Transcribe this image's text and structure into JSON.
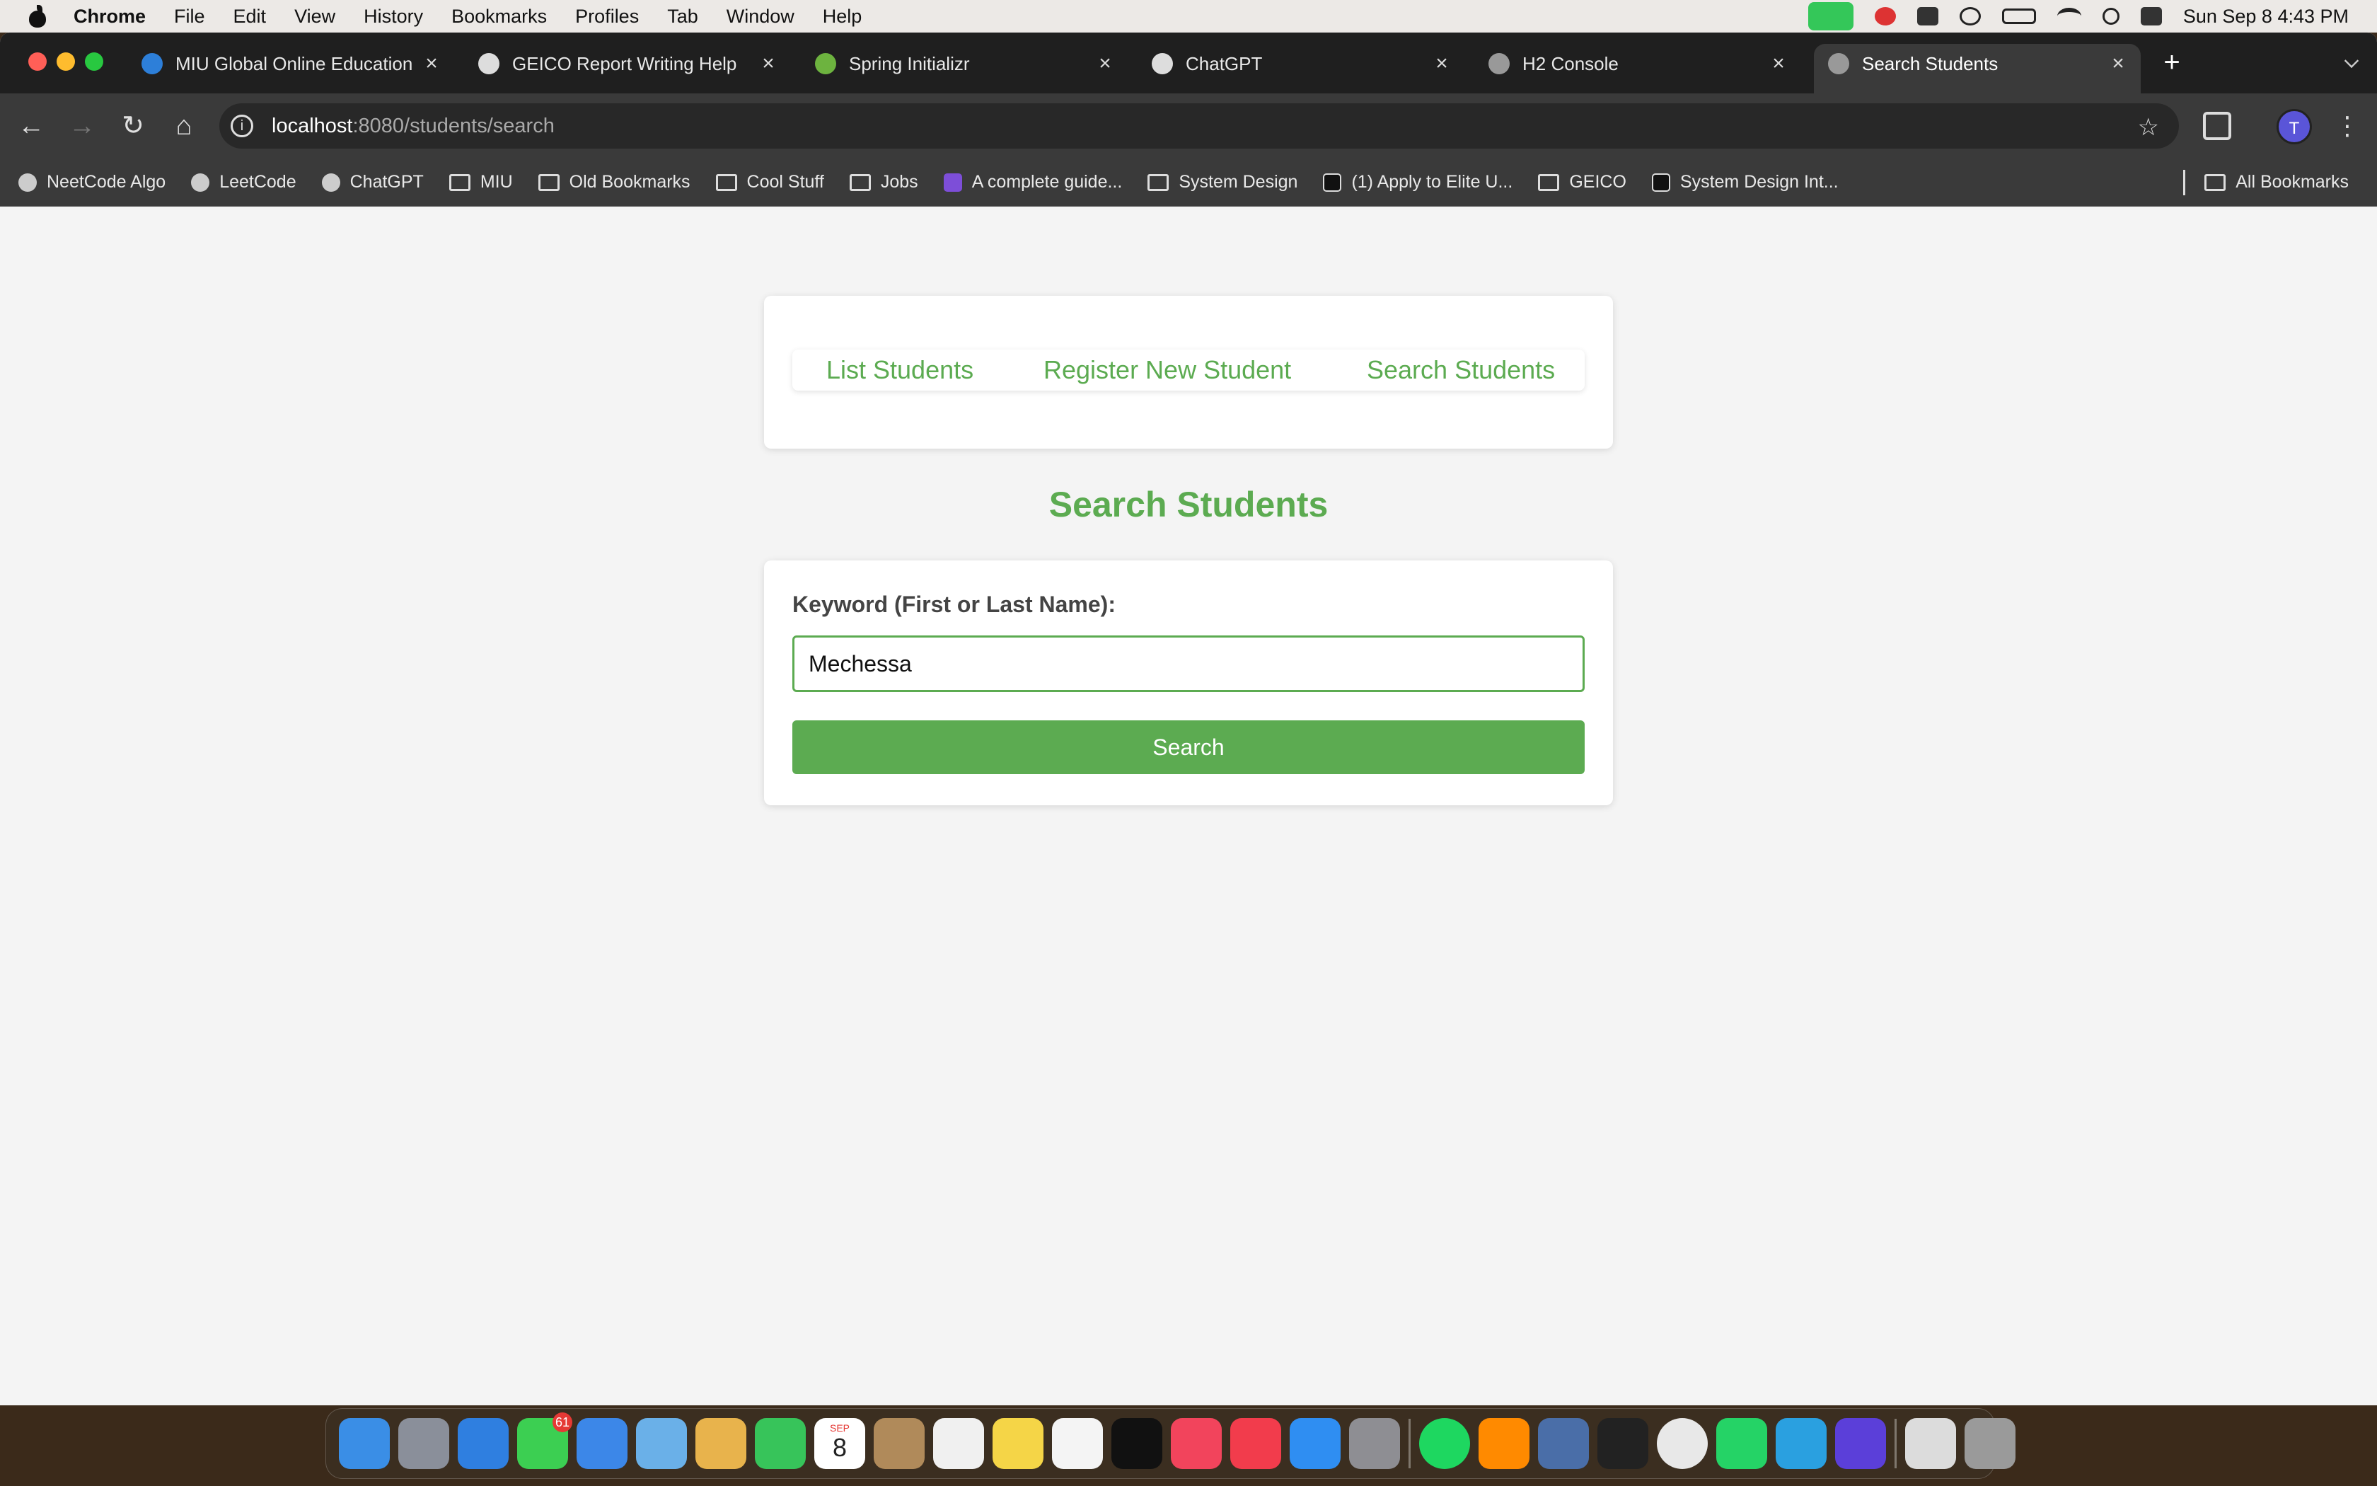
{
  "menubar": {
    "app_name": "Chrome",
    "items": [
      "File",
      "Edit",
      "View",
      "History",
      "Bookmarks",
      "Profiles",
      "Tab",
      "Window",
      "Help"
    ],
    "clock": "Sun Sep 8  4:43 PM"
  },
  "tabs": [
    {
      "title": "MIU Global Online Education :",
      "icon": "miu-icon"
    },
    {
      "title": "GEICO Report Writing Help",
      "icon": "chatgpt-icon"
    },
    {
      "title": "Spring Initializr",
      "icon": "spring-icon"
    },
    {
      "title": "ChatGPT",
      "icon": "chatgpt-icon"
    },
    {
      "title": "H2 Console",
      "icon": "globe-icon"
    },
    {
      "title": "Search Students",
      "icon": "globe-icon",
      "active": true
    }
  ],
  "omnibox": {
    "host": "localhost",
    "path": ":8080/students/search"
  },
  "profile_initial": "T",
  "bookmarks": [
    {
      "label": "NeetCode Algo",
      "icon": "neetcode-icon"
    },
    {
      "label": "LeetCode",
      "icon": "leetcode-icon"
    },
    {
      "label": "ChatGPT",
      "icon": "chatgpt-icon"
    },
    {
      "label": "MIU",
      "icon": "folder-icon"
    },
    {
      "label": "Old Bookmarks",
      "icon": "folder-icon"
    },
    {
      "label": "Cool Stuff",
      "icon": "folder-icon"
    },
    {
      "label": "Jobs",
      "icon": "folder-icon"
    },
    {
      "label": "A complete guide...",
      "icon": "rocket-icon"
    },
    {
      "label": "System Design",
      "icon": "folder-icon"
    },
    {
      "label": "(1) Apply to Elite U...",
      "icon": "tab-icon"
    },
    {
      "label": "GEICO",
      "icon": "folder-icon"
    },
    {
      "label": "System Design Int...",
      "icon": "medium-icon"
    }
  ],
  "all_bookmarks": "All Bookmarks",
  "nav": {
    "list": "List Students",
    "register": "Register New Student",
    "search": "Search Students"
  },
  "page_title": "Search Students",
  "form": {
    "label": "Keyword (First or Last Name):",
    "value": "Mechessa",
    "button": "Search"
  },
  "theme": {
    "accent": "#5cab51"
  },
  "dock": {
    "messages_badge": "61",
    "calendar_month": "SEP",
    "calendar_day": "8"
  }
}
